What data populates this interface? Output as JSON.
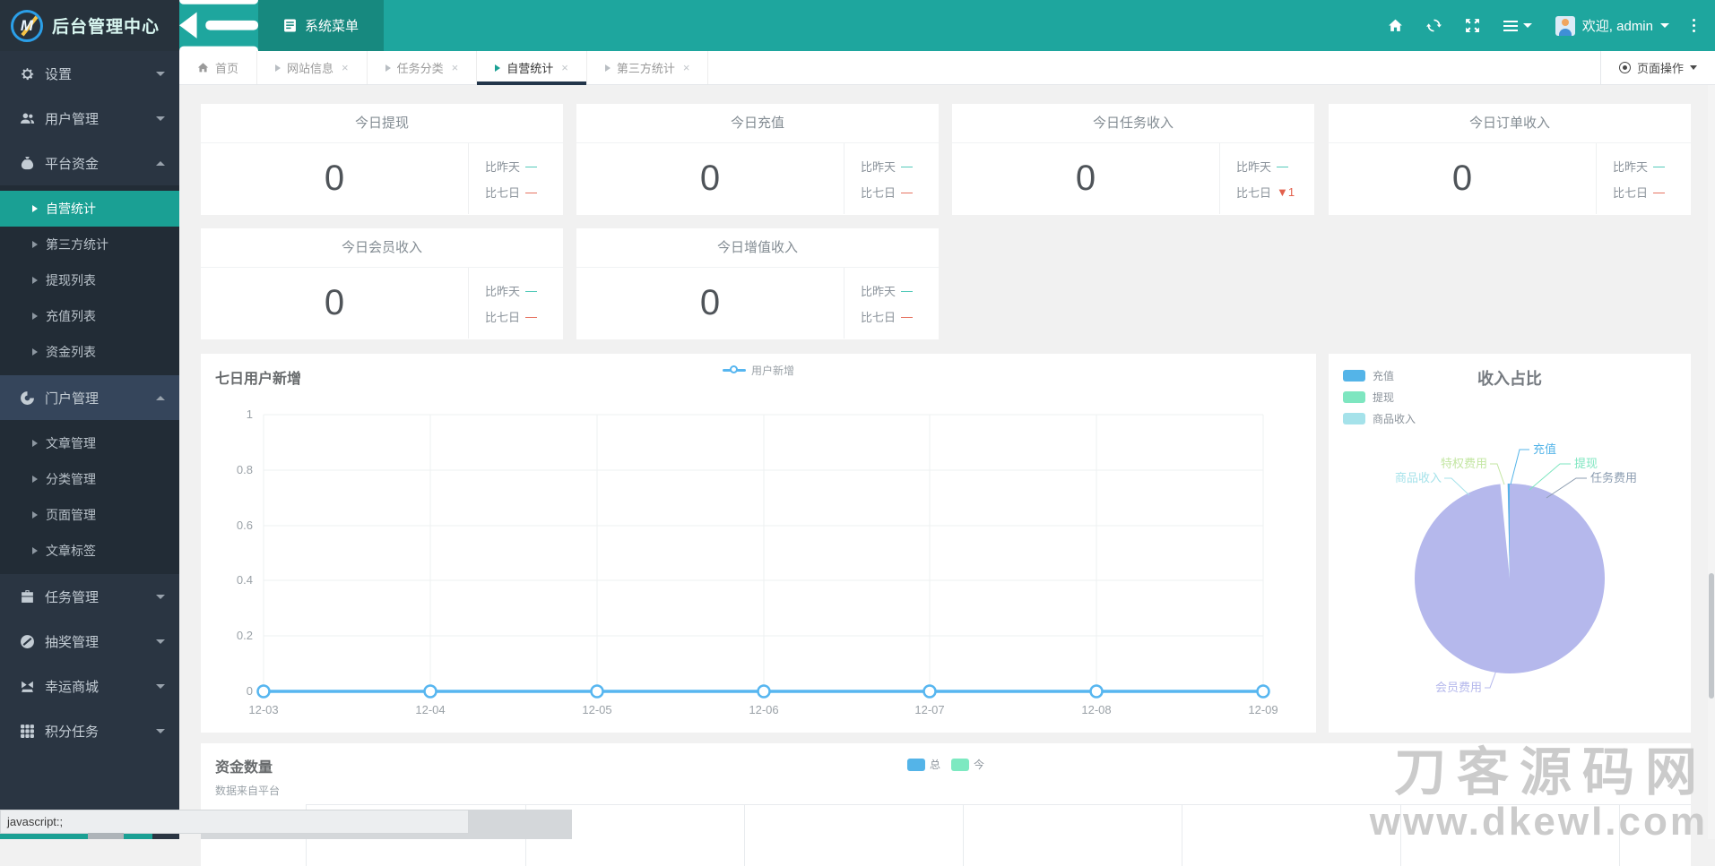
{
  "app": {
    "title": "后台管理中心"
  },
  "header": {
    "menu_label": "系统菜单",
    "welcome": "欢迎, admin"
  },
  "tabbar": {
    "tabs": [
      {
        "label": "首页"
      },
      {
        "label": "网站信息",
        "close": "×"
      },
      {
        "label": "任务分类",
        "close": "×"
      },
      {
        "label": "自营统计",
        "close": "×"
      },
      {
        "label": "第三方统计",
        "close": "×"
      }
    ],
    "page_actions": "页面操作"
  },
  "sidebar": {
    "items": [
      {
        "label": "设置"
      },
      {
        "label": "用户管理"
      },
      {
        "label": "平台资金",
        "children": [
          {
            "label": "自营统计"
          },
          {
            "label": "第三方统计"
          },
          {
            "label": "提现列表"
          },
          {
            "label": "充值列表"
          },
          {
            "label": "资金列表"
          }
        ]
      },
      {
        "label": "门户管理",
        "children": [
          {
            "label": "文章管理"
          },
          {
            "label": "分类管理"
          },
          {
            "label": "页面管理"
          },
          {
            "label": "文章标签"
          }
        ]
      },
      {
        "label": "任务管理"
      },
      {
        "label": "抽奖管理"
      },
      {
        "label": "幸运商城"
      },
      {
        "label": "积分任务"
      }
    ]
  },
  "stat_cards": [
    {
      "title": "今日提现",
      "value": "0",
      "yesterday_label": "比昨天",
      "yesterday_delta": "—",
      "week_label": "比七日",
      "week_delta": "—"
    },
    {
      "title": "今日充值",
      "value": "0",
      "yesterday_label": "比昨天",
      "yesterday_delta": "—",
      "week_label": "比七日",
      "week_delta": "—"
    },
    {
      "title": "今日任务收入",
      "value": "0",
      "yesterday_label": "比昨天",
      "yesterday_delta": "—",
      "week_label": "比七日",
      "week_delta": "▼1"
    },
    {
      "title": "今日订单收入",
      "value": "0",
      "yesterday_label": "比昨天",
      "yesterday_delta": "—",
      "week_label": "比七日",
      "week_delta": "—"
    },
    {
      "title": "今日会员收入",
      "value": "0",
      "yesterday_label": "比昨天",
      "yesterday_delta": "—",
      "week_label": "比七日",
      "week_delta": "—"
    },
    {
      "title": "今日增值收入",
      "value": "0",
      "yesterday_label": "比昨天",
      "yesterday_delta": "—",
      "week_label": "比七日",
      "week_delta": "—"
    }
  ],
  "line_chart": {
    "title": "七日用户新增",
    "legend": "用户新增",
    "x_labels": [
      "12-03",
      "12-04",
      "12-05",
      "12-06",
      "12-07",
      "12-08",
      "12-09"
    ],
    "y_ticks": [
      "1",
      "0.8",
      "0.6",
      "0.4",
      "0.2",
      "0"
    ],
    "line_color": "#57b6f0"
  },
  "pie_chart": {
    "title": "收入占比",
    "legend": [
      {
        "label": "充值",
        "color": "#54b4e8"
      },
      {
        "label": "提现",
        "color": "#7ee6c0"
      },
      {
        "label": "商品收入",
        "color": "#a5e2ea"
      }
    ],
    "labels": {
      "recharge": "充值",
      "withdraw": "提现",
      "task_fee": "任务费用",
      "privilege_fee": "特权费用",
      "goods_income": "商品收入",
      "member_fee": "会员费用"
    }
  },
  "funds": {
    "title": "资金数量",
    "subtitle": "数据来自平台",
    "legend": [
      {
        "label": "总",
        "color": "#54b4e8"
      },
      {
        "label": "今",
        "color": "#7de9c1"
      }
    ]
  },
  "watermark": {
    "line1": "刀客源码网",
    "line2": "www.dkewl.com"
  },
  "status": {
    "text": "javascript:;"
  },
  "colors": {
    "header_teal": "#1ea69e",
    "active_menu_teal": "#1aa094",
    "delta_up_teal": "#3cc3b0",
    "delta_down_orange": "#e2604c",
    "pie_main": "#b5b8ec"
  },
  "chart_data": [
    {
      "type": "line",
      "title": "七日用户新增",
      "x": [
        "12-03",
        "12-04",
        "12-05",
        "12-06",
        "12-07",
        "12-08",
        "12-09"
      ],
      "series": [
        {
          "name": "用户新增",
          "values": [
            0,
            0,
            0,
            0,
            0,
            0,
            0
          ]
        }
      ],
      "ylim": [
        0,
        1
      ],
      "yticks": [
        0,
        0.2,
        0.4,
        0.6,
        0.8,
        1
      ],
      "grid": true,
      "legend_position": "top-center"
    },
    {
      "type": "pie",
      "title": "收入占比",
      "slices": [
        {
          "label": "充值",
          "value": 0.5,
          "color": "#54b4e8"
        },
        {
          "label": "提现",
          "value": 0.3,
          "color": "#7ee6c0"
        },
        {
          "label": "任务费用",
          "value": 0.3,
          "color": "#8b9cb0"
        },
        {
          "label": "特权费用",
          "value": 0.4,
          "color": "#c3e6a2"
        },
        {
          "label": "商品收入",
          "value": 0.4,
          "color": "#a5e2ea"
        },
        {
          "label": "会员费用",
          "value": 98.1,
          "color": "#b5b8ec"
        }
      ],
      "legend": [
        "充值",
        "提现",
        "商品收入"
      ],
      "legend_position": "top-left"
    }
  ]
}
